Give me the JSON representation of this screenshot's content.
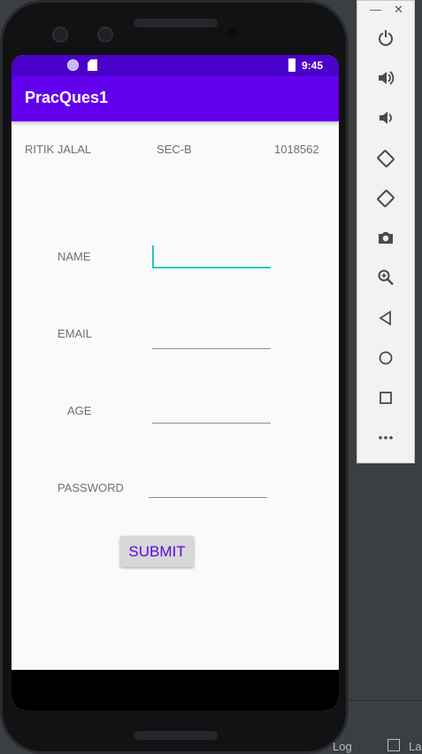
{
  "app": {
    "title": "PracQues1",
    "status_time": "9:45"
  },
  "header_row": {
    "name": "RITIK JALAL",
    "section": "SEC-B",
    "roll": "1018562"
  },
  "form": {
    "name_label": "NAME",
    "email_label": "EMAIL",
    "age_label": "AGE",
    "password_label": "PASSWORD",
    "name_value": "",
    "email_value": "",
    "age_value": "",
    "password_value": "",
    "submit_label": "SUBMIT"
  },
  "toolbar": {
    "items": [
      "power-icon",
      "volume-up-icon",
      "volume-down-icon",
      "rotate-left-icon",
      "rotate-right-icon",
      "camera-icon",
      "zoom-icon",
      "back-icon",
      "home-icon",
      "overview-icon",
      "more-icon"
    ]
  },
  "ide": {
    "label_a": "Log",
    "label_b": "La"
  },
  "colors": {
    "primary": "#6200ee",
    "primary_dark": "#4a01c9",
    "accent": "#1ec7c1"
  }
}
